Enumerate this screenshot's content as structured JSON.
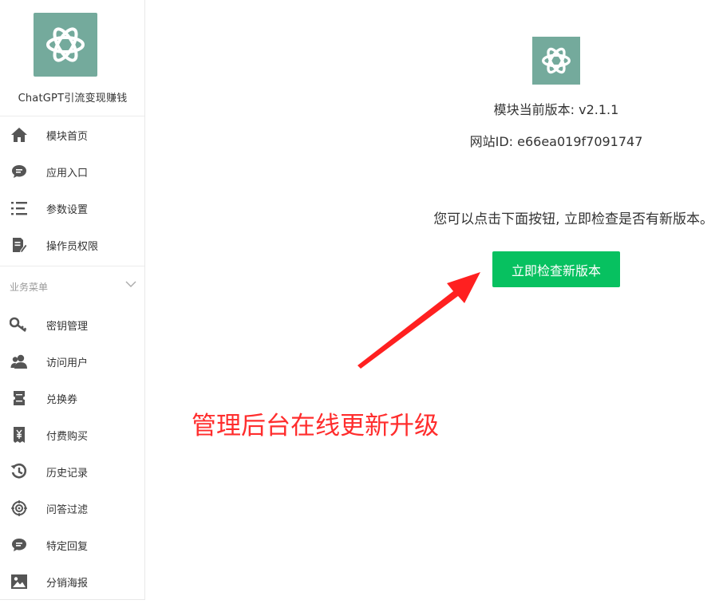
{
  "sidebar": {
    "brand_name": "ChatGPT引流变现赚钱",
    "top_items": [
      {
        "label": "模块首页",
        "icon": "home-icon"
      },
      {
        "label": "应用入口",
        "icon": "chat-bubble-icon"
      },
      {
        "label": "参数设置",
        "icon": "list-icon"
      },
      {
        "label": "操作员权限",
        "icon": "edit-document-icon"
      }
    ],
    "section_title": "业务菜单",
    "business_items": [
      {
        "label": "密钥管理",
        "icon": "key-icon"
      },
      {
        "label": "访问用户",
        "icon": "users-icon"
      },
      {
        "label": "兑换券",
        "icon": "ticket-icon"
      },
      {
        "label": "付费购买",
        "icon": "payment-icon"
      },
      {
        "label": "历史记录",
        "icon": "history-icon"
      },
      {
        "label": "问答过滤",
        "icon": "filter-target-icon"
      },
      {
        "label": "特定回复",
        "icon": "chat-bubble-icon"
      },
      {
        "label": "分销海报",
        "icon": "image-icon"
      }
    ]
  },
  "main": {
    "version_text": "模块当前版本: v2.1.1",
    "site_id_text": "网站ID: e66ea019f7091747",
    "hint_text": "您可以点击下面按钮, 立即检查是否有新版本。",
    "check_button_label": "立即检查新版本"
  },
  "annotation": {
    "text": "管理后台在线更新升级"
  },
  "colors": {
    "brand": "#74aa9c",
    "button": "#07c160",
    "annotation": "#ff2d2d",
    "icon": "#555555"
  }
}
